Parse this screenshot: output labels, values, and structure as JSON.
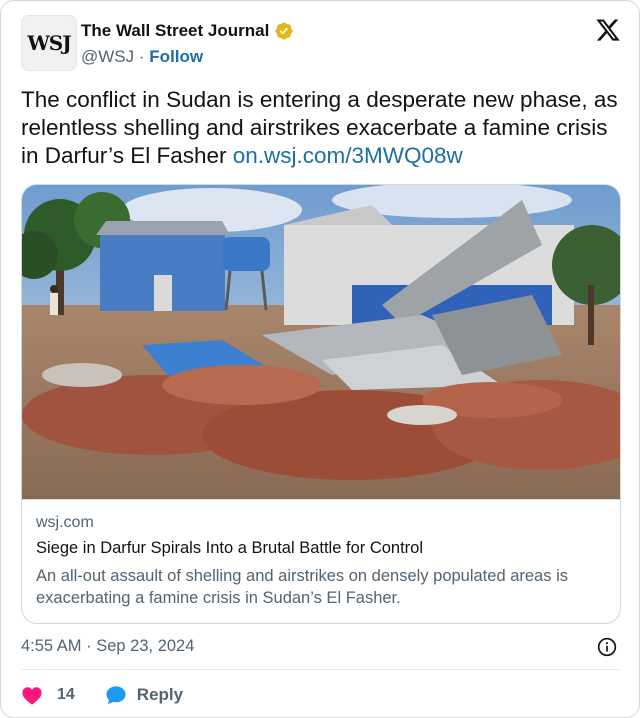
{
  "author": {
    "name": "The Wall Street Journal",
    "handle": "@WSJ",
    "separator": "·",
    "follow_label": "Follow",
    "avatar_text": "WSJ",
    "verified_color": "#e2b719"
  },
  "tweet": {
    "text": "The conflict in Sudan is entering a desperate new phase, as relentless shelling and airstrikes exacerbate a famine crisis in Darfur’s El Fasher ",
    "link_text": "on.wsj.com/3MWQ08w"
  },
  "link_card": {
    "domain": "wsj.com",
    "title": "Siege in Darfur Spirals Into a Brutal Battle for Control",
    "description": "An all-out assault of shelling and airstrikes on densely populated areas is exacerbating a famine crisis in Sudan’s El Fasher."
  },
  "meta": {
    "time": "4:55 AM",
    "separator": "·",
    "date": "Sep 23, 2024"
  },
  "actions": {
    "like_count": "14",
    "reply_label": "Reply",
    "like_color": "#f91880",
    "reply_color": "#1d9bf0"
  },
  "icons": {
    "platform": "x-logo-icon",
    "verified": "verified-badge-icon",
    "info": "info-icon",
    "like": "heart-icon",
    "reply": "reply-bubble-icon"
  }
}
